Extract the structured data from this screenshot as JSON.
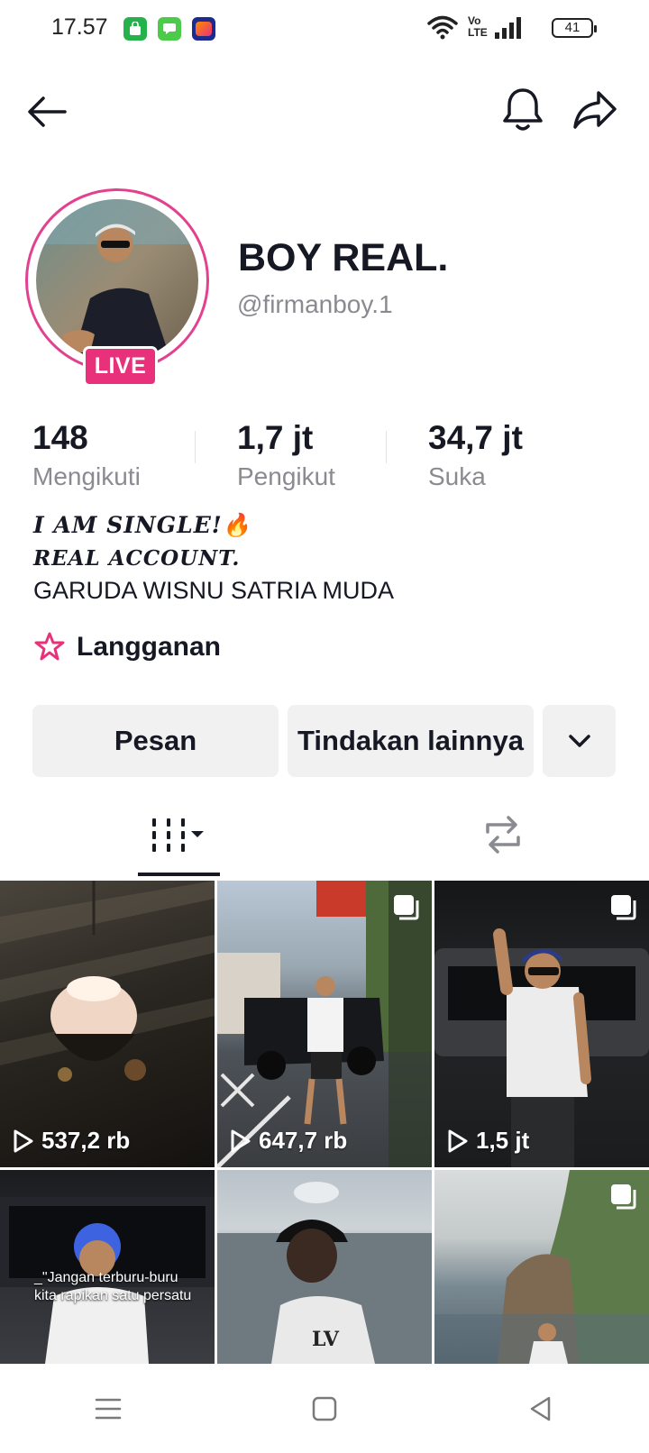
{
  "status_bar": {
    "time": "17.57",
    "volte": "Vo LTE",
    "battery": "41",
    "notification_icons": [
      "store-icon",
      "messages-icon",
      "lazada-icon"
    ]
  },
  "profile": {
    "display_name": "BOY REAL.",
    "username": "@firmanboy.1",
    "live_badge": "LIVE",
    "accent_color": "#e8317a"
  },
  "stats": [
    {
      "value": "148",
      "label": "Mengikuti"
    },
    {
      "value": "1,7 jt",
      "label": "Pengikut"
    },
    {
      "value": "34,7 jt",
      "label": "Suka"
    }
  ],
  "bio": {
    "line1": "I AM SINGLE!🔥",
    "line2": "REAL ACCOUNT.",
    "line3": "GARUDA WISNU SATRIA MUDA"
  },
  "subscription": {
    "label": "Langganan"
  },
  "actions": {
    "message": "Pesan",
    "more_actions": "Tindakan lainnya"
  },
  "videos": [
    {
      "views": "537,2 rb",
      "pinned": false
    },
    {
      "views": "647,7 rb",
      "pinned": true
    },
    {
      "views": "1,5 jt",
      "pinned": true
    },
    {
      "views": "",
      "pinned": false,
      "caption": "_\"Jangan terburu-buru kita rapikan satu persatu"
    },
    {
      "views": "",
      "pinned": false
    },
    {
      "views": "",
      "pinned": true
    }
  ]
}
